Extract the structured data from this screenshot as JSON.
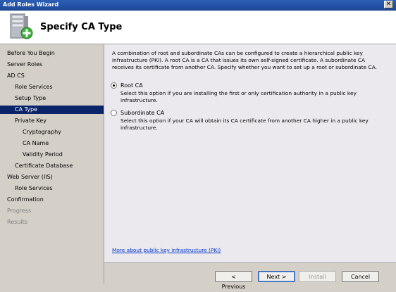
{
  "window": {
    "title": "Add Roles Wizard",
    "close_glyph": "✕"
  },
  "header": {
    "page_title": "Specify CA Type",
    "icon": "server-add-icon"
  },
  "sidebar": {
    "items": [
      {
        "label": "Before You Begin",
        "indent": 0,
        "state": "normal"
      },
      {
        "label": "Server Roles",
        "indent": 0,
        "state": "normal"
      },
      {
        "label": "AD CS",
        "indent": 0,
        "state": "normal"
      },
      {
        "label": "Role Services",
        "indent": 1,
        "state": "normal"
      },
      {
        "label": "Setup Type",
        "indent": 1,
        "state": "normal"
      },
      {
        "label": "CA Type",
        "indent": 1,
        "state": "active"
      },
      {
        "label": "Private Key",
        "indent": 1,
        "state": "normal"
      },
      {
        "label": "Cryptography",
        "indent": 2,
        "state": "normal"
      },
      {
        "label": "CA Name",
        "indent": 2,
        "state": "normal"
      },
      {
        "label": "Validity Period",
        "indent": 2,
        "state": "normal"
      },
      {
        "label": "Certificate Database",
        "indent": 1,
        "state": "normal"
      },
      {
        "label": "Web Server (IIS)",
        "indent": 0,
        "state": "normal"
      },
      {
        "label": "Role Services",
        "indent": 1,
        "state": "normal"
      },
      {
        "label": "Confirmation",
        "indent": 0,
        "state": "normal"
      },
      {
        "label": "Progress",
        "indent": 0,
        "state": "disabled"
      },
      {
        "label": "Results",
        "indent": 0,
        "state": "disabled"
      }
    ]
  },
  "content": {
    "description": "A combination of root and subordinate CAs can be configured to create a hierarchical public key infrastructure (PKI). A root CA is a CA that issues its own self-signed certificate. A subordinate CA receives its certificate from another CA. Specify whether you want to set up a root or subordinate CA.",
    "options": [
      {
        "label": "Root CA",
        "selected": true,
        "description": "Select this option if you are installing the first or only certification authority in a public key infrastructure."
      },
      {
        "label": "Subordinate CA",
        "selected": false,
        "description": "Select this option if your CA will obtain its CA certificate from another CA higher in a public key infrastructure."
      }
    ],
    "link": "More about public key infrastructure (PKI)"
  },
  "footer": {
    "previous_label": "< Previous",
    "next_label": "Next >",
    "install_label": "Install",
    "cancel_label": "Cancel"
  }
}
